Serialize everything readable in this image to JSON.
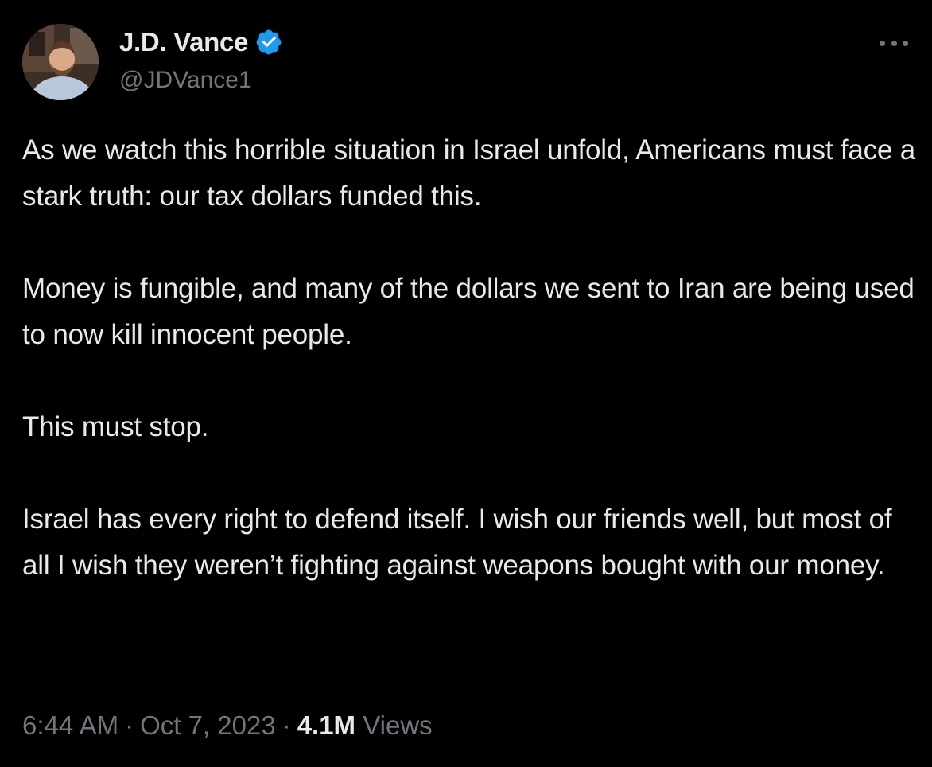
{
  "author": {
    "display_name": "J.D. Vance",
    "handle": "@JDVance1",
    "verified": true,
    "verified_color": "#1d9bf0",
    "avatar_icon": "profile-photo"
  },
  "menu": {
    "icon": "more-horizontal-icon"
  },
  "tweet": {
    "paragraphs": [
      "As we watch this horrible situation in Israel unfold, Americans must face a stark truth: our tax dollars funded this.",
      "Money is fungible, and many of the dollars we sent to Iran are being used to now kill innocent people.",
      "This must stop.",
      "Israel has every right to defend itself. I wish our friends well, but most of all I wish they weren’t fighting against weapons bought with our money."
    ]
  },
  "meta": {
    "time": "6:44 AM",
    "separator": "·",
    "date": "Oct 7, 2023",
    "views_count": "4.1M",
    "views_label": "Views"
  },
  "colors": {
    "background": "#000000",
    "primary_text": "#e7e9ea",
    "secondary_text": "#71767b"
  }
}
